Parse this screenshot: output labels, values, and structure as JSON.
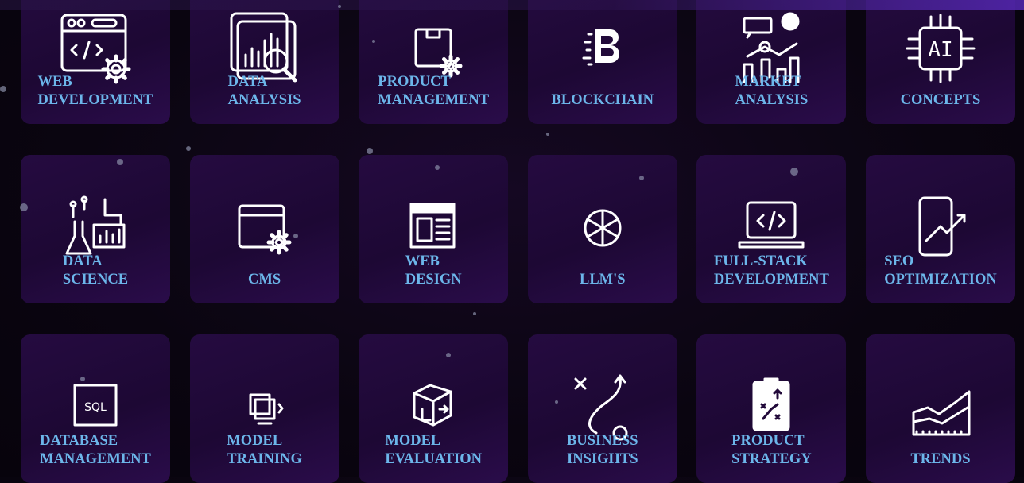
{
  "cards": [
    {
      "label": "Web\nDevelopment",
      "icon": "web-development-icon"
    },
    {
      "label": "Data\nAnalysis",
      "icon": "data-analysis-icon"
    },
    {
      "label": "Product\nManagement",
      "icon": "product-management-icon"
    },
    {
      "label": "Blockchain",
      "icon": "blockchain-icon"
    },
    {
      "label": "Market\nAnalysis",
      "icon": "market-analysis-icon"
    },
    {
      "label": "Concepts",
      "icon": "ai-chip-icon"
    },
    {
      "label": "Data\nScience",
      "icon": "data-science-icon"
    },
    {
      "label": "CMS",
      "icon": "cms-icon"
    },
    {
      "label": "Web\nDesign",
      "icon": "web-design-icon"
    },
    {
      "label": "LLM's",
      "icon": "llm-icon"
    },
    {
      "label": "Full-Stack\nDevelopment",
      "icon": "laptop-code-icon"
    },
    {
      "label": "SEO\nOptimization",
      "icon": "seo-phone-icon"
    },
    {
      "label": "Database\nManagement",
      "icon": "sql-icon"
    },
    {
      "label": "Model\nTraining",
      "icon": "model-training-icon"
    },
    {
      "label": "Model\nEvaluation",
      "icon": "model-evaluation-icon"
    },
    {
      "label": "Business\nInsights",
      "icon": "strategy-path-icon"
    },
    {
      "label": "Product\nStrategy",
      "icon": "clipboard-strategy-icon"
    },
    {
      "label": "Trends",
      "icon": "trend-chart-icon"
    }
  ],
  "colors": {
    "label": "#6cb6ea",
    "card": "#220a3a",
    "accent": "#5a2bc0"
  }
}
